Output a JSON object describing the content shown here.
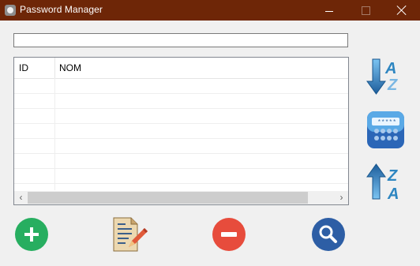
{
  "window": {
    "title": "Password Manager",
    "minimize_label": "Minimize",
    "maximize_label": "Maximize",
    "close_label": "Close"
  },
  "search": {
    "value": "",
    "placeholder": ""
  },
  "table": {
    "columns": [
      "ID",
      "NOM"
    ],
    "rows": []
  },
  "side_buttons": {
    "sort_asc_icon": "sort-az-icon",
    "calculator_icon": "calculator-icon",
    "sort_desc_icon": "sort-za-icon"
  },
  "bottom_buttons": {
    "add_icon": "plus-icon",
    "edit_icon": "edit-document-icon",
    "remove_icon": "minus-icon",
    "search_icon": "magnifier-icon"
  },
  "colors": {
    "titlebar": "#6e2607",
    "add": "#27ae60",
    "remove": "#e74c3c",
    "search": "#2d5ea5",
    "sort_arrow": "#2e86c1"
  }
}
